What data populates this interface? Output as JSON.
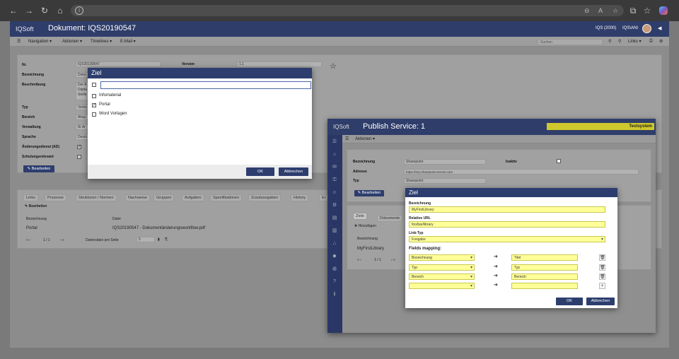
{
  "browser": {
    "zoom_icons": [
      "zoom-out-icon",
      "read-aloud-icon",
      "favorite-icon"
    ]
  },
  "app": {
    "logo": "IQSoft",
    "title": "Dokument: IQS20190547",
    "user_code": "IQS (2000)",
    "user_name": "IQS\\ANI",
    "toolbar": {
      "navigation": "Navigation ▾",
      "aktionen": "Aktionen ▾",
      "timelines": "Timelines ▾",
      "email": "E-Mail ▾",
      "search_placeholder": "Suchen",
      "links": "Links ▾"
    },
    "form": {
      "nr_label": "Nr.",
      "nr_value": "IQS20190547",
      "version_label": "Version",
      "version_value": "1.1",
      "bezeichnung_label": "Bezeichnung",
      "bezeichnung_value": "Doku",
      "beschreibung_label": "Beschreibung",
      "beschreibung_lines": [
        "Der A",
        "Digita",
        "Stelle"
      ],
      "typ_label": "Typ",
      "typ_value": "Verka",
      "bereich_label": "Bereich",
      "bereich_value": "Akqu",
      "verwaltung_label": "Verwaltung",
      "verwaltung_value": "IE Ar",
      "sprache_label": "Sprache",
      "sprache_value": "Deuts",
      "aenderungsdienst_label": "Änderungsdienst (AD)",
      "schulungsrelevant_label": "Schulungsrelevant",
      "edit_button": "Bearbeiten"
    },
    "tabs": [
      "Links",
      "Prozesse",
      "Strukturen / Normen",
      "Nachweise",
      "Gruppen",
      "Aufgaben",
      "Spezifikationen",
      "Zusatzangaben",
      "History",
      "Er"
    ],
    "tab_edit": "Bearbeiten",
    "grid": {
      "headers": [
        "Bezeichnung",
        "Datei"
      ],
      "rows": [
        [
          "Portal",
          "IQS20190547 - Dokumentänderungsworkflow.pdf"
        ]
      ],
      "pager": "1 / 1",
      "page_size_label": "Datensätze pro Seite",
      "page_size": "5"
    }
  },
  "ziel1": {
    "title": "Ziel",
    "options": [
      {
        "label": "Infomaterial",
        "checked": false
      },
      {
        "label": "Portal",
        "checked": true
      },
      {
        "label": "Word Vorlagen",
        "checked": false
      }
    ],
    "ok": "OK",
    "cancel": "Abbrechen"
  },
  "publish": {
    "logo": "IQSoft",
    "title": "Publish Service: 1",
    "badge": "Testsystem",
    "aktionen": "Aktionen ▾",
    "bezeichnung_label": "Bezeichnung",
    "bezeichnung_value": "Sharepoint",
    "inaktiv_label": "Inaktiv",
    "adresse_label": "Adresse",
    "adresse_value": "https://myi.sharepoint.server.com",
    "typ_label": "Typ",
    "typ_value": "Sharepoint",
    "edit_button": "Bearbeiten",
    "tabs": [
      "Ziele",
      "Dokumente"
    ],
    "add": "Hinzufügen",
    "grid_header": "Bezeichnung",
    "grid_row": "MyFirstLibrary",
    "pager": "1 / 1"
  },
  "ziel2": {
    "title": "Ziel",
    "bezeichnung_label": "Bezeichnung",
    "bezeichnung_value": "MyFirstLibrary",
    "url_label": "Relative URL",
    "url_value": "foo/bar/library",
    "linktyp_label": "Link-Typ",
    "linktyp_value": "Freigabe",
    "mapping_label": "Fields mapping:",
    "mappings": [
      {
        "source": "Bezeichnung",
        "target": "Titel"
      },
      {
        "source": "Typ",
        "target": "Typ"
      },
      {
        "source": "Bereich",
        "target": "Bereich"
      },
      {
        "source": "",
        "target": ""
      }
    ],
    "ok": "OK",
    "cancel": "Abbrechen"
  }
}
